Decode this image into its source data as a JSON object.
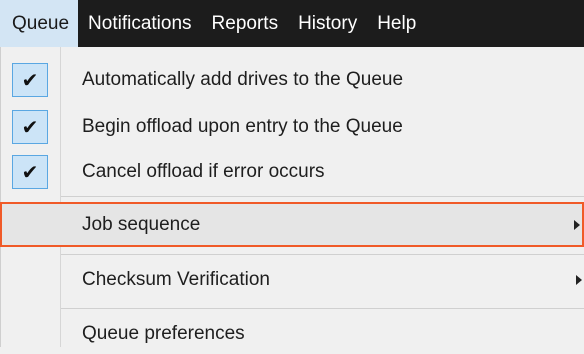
{
  "menubar": {
    "items": [
      {
        "label": "Queue"
      },
      {
        "label": "Notifications"
      },
      {
        "label": "Reports"
      },
      {
        "label": "History"
      },
      {
        "label": "Help"
      }
    ]
  },
  "dropdown": {
    "items": [
      {
        "label": "Automatically add drives to the Queue",
        "checked": true,
        "check_glyph": "✔"
      },
      {
        "label": "Begin offload upon entry to the Queue",
        "checked": true,
        "check_glyph": "✔"
      },
      {
        "label": "Cancel offload if error occurs",
        "checked": true,
        "check_glyph": "✔"
      },
      {
        "label": "Job sequence",
        "has_submenu": true
      },
      {
        "label": "Checksum Verification",
        "has_submenu": true
      },
      {
        "label": "Queue preferences"
      }
    ]
  },
  "colors": {
    "menubar_bg": "#1c1c1c",
    "active_menu_bg": "#d3e5f4",
    "highlight_border": "#f05a28",
    "check_bg": "#cce4f7",
    "check_border": "#5aa7e2"
  }
}
